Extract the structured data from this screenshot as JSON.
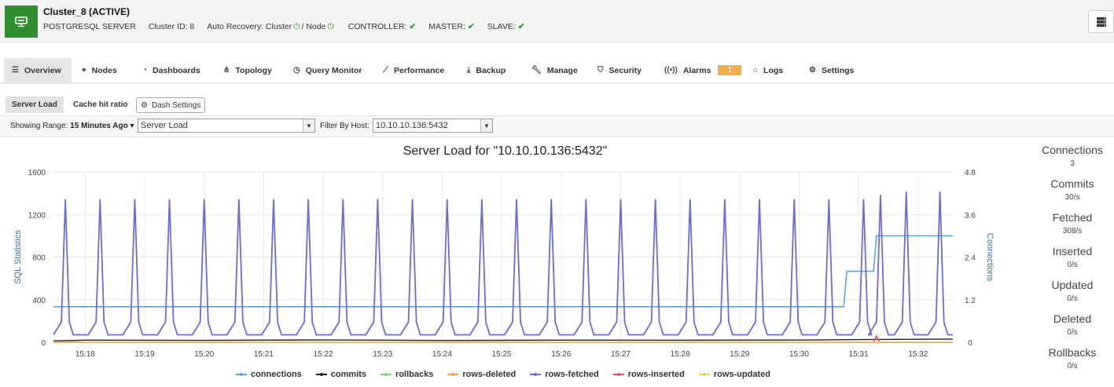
{
  "header": {
    "title": "Cluster_8 (ACTIVE)",
    "server_type": "POSTGRESQL SERVER",
    "cluster_id": "Cluster ID: 8",
    "auto_recovery_label": "Auto Recovery: Cluster",
    "auto_recovery_sep": "/ Node",
    "controller": "CONTROLLER:",
    "master": "MASTER:",
    "slave": "SLAVE:",
    "check_glyph": "✔",
    "power_glyph": "⏻",
    "accent_color": "#2f8f2f"
  },
  "nav": {
    "tabs": [
      {
        "label": "Overview",
        "icon": "list-icon",
        "active": true
      },
      {
        "label": "Nodes",
        "icon": "nodes-icon"
      },
      {
        "label": "Dashboards",
        "icon": "dashboard-icon"
      },
      {
        "label": "Topology",
        "icon": "topology-icon"
      },
      {
        "label": "Query Monitor",
        "icon": "clock-icon"
      },
      {
        "label": "Performance",
        "icon": "line-chart-icon"
      },
      {
        "label": "Backup",
        "icon": "download-icon"
      },
      {
        "label": "Manage",
        "icon": "wrench-icon"
      },
      {
        "label": "Security",
        "icon": "shield-icon"
      },
      {
        "label": "Alarms",
        "icon": "broadcast-icon",
        "badge": "1"
      },
      {
        "label": "Logs",
        "icon": "inbox-icon"
      },
      {
        "label": "Settings",
        "icon": "gear-icon"
      }
    ]
  },
  "subtabs": {
    "items": [
      "Server Load",
      "Cache hit ratio"
    ],
    "dash_settings": "Dash Settings"
  },
  "filters": {
    "range_label": "Showing Range:",
    "range_value": "15 Minutes Ago",
    "dashboard_select": "Server Load",
    "host_label": "Filter By Host:",
    "host_select": "10.10.10.136:5432"
  },
  "stats": [
    {
      "label": "Connections",
      "value": "3"
    },
    {
      "label": "Commits",
      "value": "30/s"
    },
    {
      "label": "Fetched",
      "value": "308/s"
    },
    {
      "label": "Inserted",
      "value": "0/s"
    },
    {
      "label": "Updated",
      "value": "0/s"
    },
    {
      "label": "Deleted",
      "value": "0/s"
    },
    {
      "label": "Rollbacks",
      "value": "0/s"
    }
  ],
  "chart_data": {
    "type": "line",
    "title": "Server Load for \"10.10.10.136:5432\"",
    "ylabel": "SQL Statistics",
    "y2label": "Connections",
    "ylim": [
      0,
      1600
    ],
    "y2lim": [
      0,
      4.8
    ],
    "yticks": [
      "0",
      "400",
      "800",
      "1200",
      "1600"
    ],
    "y2ticks": [
      "0",
      "1.2",
      "2.4",
      "3.6",
      "4.8"
    ],
    "xticks": [
      "15:18",
      "15:19",
      "15:20",
      "15:21",
      "15:22",
      "15:23",
      "15:24",
      "15:25",
      "15:26",
      "15:27",
      "15:28",
      "15:29",
      "15:30",
      "15:31",
      "15:32"
    ],
    "xrange": [
      "15:17:28",
      "15:32:35"
    ],
    "grid": true,
    "legend": "bottom",
    "series": [
      {
        "name": "connections",
        "color": "#5aa4dc",
        "axis": "right",
        "points": [
          [
            "15:17:28",
            1
          ],
          [
            "15:30:45",
            1
          ],
          [
            "15:30:48",
            2
          ],
          [
            "15:31:15",
            2
          ],
          [
            "15:31:18",
            3
          ],
          [
            "15:32:35",
            3
          ]
        ]
      },
      {
        "name": "commits",
        "color": "#222222",
        "axis": "left",
        "points": [
          [
            "15:17:28",
            12
          ],
          [
            "15:18:00",
            20
          ],
          [
            "15:20:00",
            18
          ],
          [
            "15:22:00",
            22
          ],
          [
            "15:24:00",
            17
          ],
          [
            "15:26:00",
            20
          ],
          [
            "15:28:00",
            19
          ],
          [
            "15:30:00",
            21
          ],
          [
            "15:31:00",
            25
          ],
          [
            "15:32:00",
            28
          ],
          [
            "15:32:35",
            30
          ]
        ]
      },
      {
        "name": "rollbacks",
        "color": "#7fd07f",
        "axis": "left",
        "points": [
          [
            "15:17:28",
            0
          ],
          [
            "15:32:35",
            0
          ]
        ]
      },
      {
        "name": "rows-deleted",
        "color": "#f0a050",
        "axis": "left",
        "points": [
          [
            "15:17:28",
            0
          ],
          [
            "15:32:35",
            0
          ]
        ]
      },
      {
        "name": "rows-fetched",
        "color": "#6b6bd8",
        "axis": "left",
        "peaks": [
          "15:17:40",
          "15:18:15",
          "15:18:50",
          "15:19:25",
          "15:20:00",
          "15:20:35",
          "15:21:10",
          "15:21:45",
          "15:22:20",
          "15:22:55",
          "15:23:30",
          "15:24:05",
          "15:24:40",
          "15:25:15",
          "15:25:50",
          "15:26:25",
          "15:27:00",
          "15:27:35",
          "15:28:10",
          "15:28:45",
          "15:29:20",
          "15:29:55",
          "15:30:30",
          "15:31:05",
          "15:31:22",
          "15:31:48",
          "15:32:22"
        ],
        "peak_values": [
          1340,
          1340,
          1340,
          1340,
          1340,
          1340,
          1340,
          1340,
          1340,
          1340,
          1340,
          1340,
          1340,
          1340,
          1340,
          1340,
          1340,
          1340,
          1340,
          1340,
          1340,
          1340,
          1340,
          1340,
          1380,
          1410,
          1410
        ],
        "base": 70
      },
      {
        "name": "rows-inserted",
        "color": "#e0506a",
        "axis": "left",
        "points": [
          [
            "15:17:28",
            0
          ],
          [
            "15:31:15",
            0
          ],
          [
            "15:31:18",
            60
          ],
          [
            "15:31:21",
            0
          ],
          [
            "15:32:35",
            0
          ]
        ]
      },
      {
        "name": "rows-updated",
        "color": "#e8cf50",
        "axis": "left",
        "points": [
          [
            "15:17:28",
            2
          ],
          [
            "15:32:35",
            2
          ]
        ]
      }
    ]
  }
}
